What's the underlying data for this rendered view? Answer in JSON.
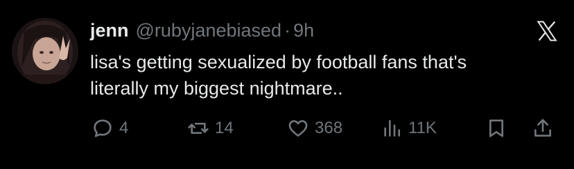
{
  "author": {
    "name": "jenn",
    "handle": "@rubyjanebiased",
    "separator": "·",
    "time": "9h"
  },
  "tweet": {
    "lines": [
      "lisa's getting sexualized by football fans that's",
      "literally my biggest nightmare.."
    ]
  },
  "metrics": {
    "replies": "4",
    "retweets": "14",
    "likes": "368",
    "views": "11K"
  },
  "icons": {
    "brand": "x-logo-icon",
    "reply": "reply-icon",
    "retweet": "retweet-icon",
    "like": "heart-icon",
    "views": "views-chart-icon",
    "bookmark": "bookmark-icon",
    "share": "share-icon"
  },
  "colors": {
    "background": "#000000",
    "primary_text": "#e7e9ea",
    "secondary_text": "#71767b"
  }
}
